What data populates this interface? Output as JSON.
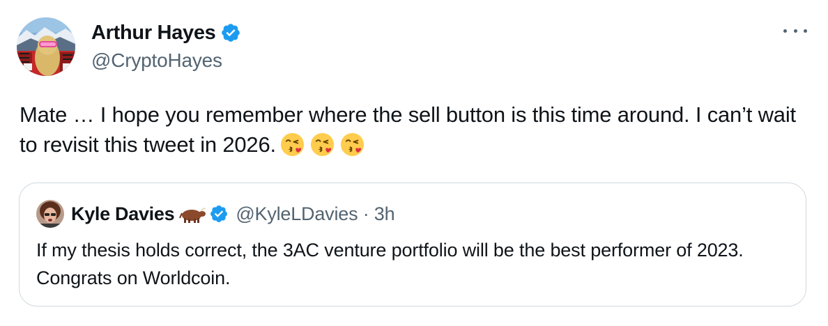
{
  "author": {
    "display_name": "Arthur Hayes",
    "handle": "@CryptoHayes",
    "verified": true
  },
  "tweet": {
    "text": "Mate … I hope you remember where the sell button is this time around. I can’t wait to revisit this tweet in 2026.",
    "emojis": [
      "kissing-face-heart",
      "kissing-face-heart",
      "kissing-face-heart"
    ]
  },
  "quoted_tweet": {
    "display_name": "Kyle Davies",
    "name_emoji": "ox",
    "verified": true,
    "handle_time": "@KyleLDavies · 3h",
    "text": "If my thesis holds correct, the 3AC venture portfolio will be the best performer of 2023. Congrats on Worldcoin."
  },
  "colors": {
    "text": "#0f1419",
    "secondary": "#536471",
    "verified_blue": "#1d9bf0",
    "border": "#cfd9de"
  },
  "icons": [
    "verified-badge-icon",
    "more-options-icon",
    "kissing-face-emoji-icon",
    "ox-emoji-icon"
  ]
}
